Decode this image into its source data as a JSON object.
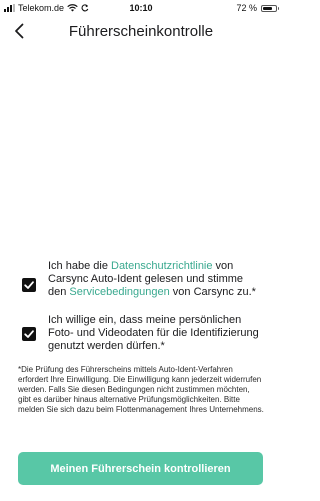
{
  "status_bar": {
    "carrier": "Telekom.de",
    "time": "10:10",
    "battery_text": "72 %",
    "battery_level": 0.72,
    "icons": [
      "signal-icon",
      "wifi-icon",
      "sync-icon",
      "battery-icon"
    ]
  },
  "header": {
    "title": "Führerscheinkontrolle",
    "back_icon": "chevron-left-icon"
  },
  "consent_1": {
    "checked": true,
    "text_before": "Ich habe die ",
    "link_1": "Datenschutzrichtlinie",
    "text_middle": " von Carsync Auto-Ident gelesen und stimme den ",
    "link_2": "Servicebedingungen",
    "text_after": " von Carsync zu.*"
  },
  "consent_2": {
    "checked": true,
    "text": "Ich willige ein, dass meine persönlichen Foto- und Videodaten für die Identifizierung genutzt werden dürfen.*"
  },
  "footnote": "*Die Prüfung des Führerscheins mittels Auto-Ident-Verfahren erfordert Ihre Einwilligung. Die Einwilligung kann jederzeit widerrufen werden. Falls Sie diesen Bedingungen nicht zustimmen möchten, gibt es darüber hinaus alternative Prüfungsmöglichkeiten. Bitte melden Sie sich dazu beim Flottenmanagement Ihres Unternehmens.",
  "primary_button": {
    "label": "Meinen Führerschein kontrollieren"
  },
  "colors": {
    "accent": "#58c7a6",
    "link": "#3aa98f",
    "text": "#1c1c1e",
    "checkbox": "#111111"
  }
}
